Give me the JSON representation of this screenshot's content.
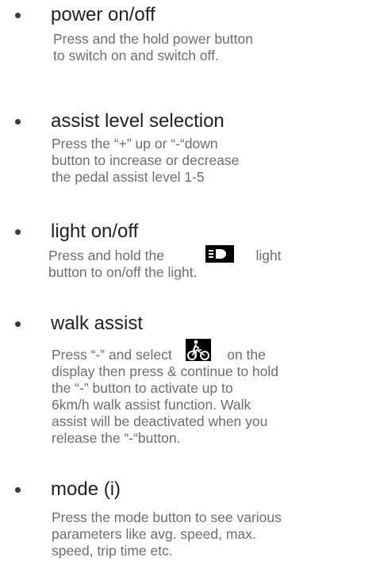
{
  "items": [
    {
      "title": "power on/off",
      "lines": [
        "Press and the hold power button",
        " to switch on and switch off."
      ]
    },
    {
      "title": "assist level selection",
      "lines": [
        "Press the “+” up or “-“down",
        " button to increase or decrease",
        " the pedal assist level 1-5"
      ]
    },
    {
      "title": "light on/off",
      "line1_before": "Press and hold the",
      "line1_after": "light",
      "icon": "headlight-icon",
      "line2": "button to on/off the light."
    },
    {
      "title": "walk assist",
      "line1_before": "Press “-” and select",
      "line1_after": "on the",
      "icon": "walking-bike-icon",
      "lines": [
        "display then press & continue to hold",
        "the “-” button to activate up to",
        "6km/h walk assist function. Walk",
        "assist will be deactivated when you",
        "release the “-“button."
      ]
    },
    {
      "title": "mode (i)",
      "lines": [
        "Press the mode button to see various",
        "parameters like avg. speed, max.",
        "speed, trip time etc."
      ]
    }
  ]
}
